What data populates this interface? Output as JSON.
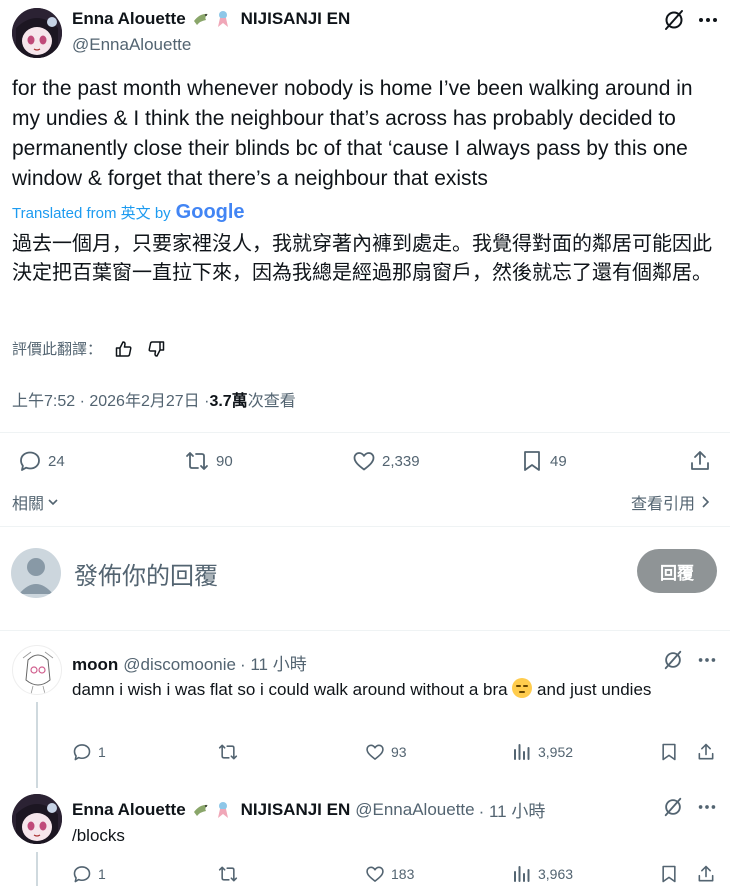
{
  "tweet": {
    "author_name": "Enna Alouette",
    "author_affiliation": "NIJISANJI EN",
    "author_handle": "@EnnaAlouette",
    "text": "for the past month whenever nobody is home I’ve been walking around in my undies & I think the neighbour that’s across has probably decided to permanently close their blinds bc of that ‘cause I always pass by this one window & forget that there’s a neighbour that exists",
    "translated_from": "Translated from 英文 by",
    "translator_logo": "Google",
    "translation": "過去一個月，只要家裡沒人，我就穿著內褲到處走。我覺得對面的鄰居可能因此決定把百葉窗一直拉下來，因為我總是經過那扇窗戶，然後就忘了還有個鄰居。",
    "rate_translation": "評價此翻譯：",
    "time": "上午7:52 · 2026年2月27日 · ",
    "views_count": "3.7萬",
    "views_label": " 次查看",
    "stats": {
      "replies": "24",
      "retweets": "90",
      "likes": "2,339",
      "bookmarks": "49"
    },
    "related": "相關",
    "view_quotes": "查看引用"
  },
  "composer": {
    "placeholder": "發佈你的回覆",
    "reply_button": "回覆"
  },
  "replies": [
    {
      "name": "moon",
      "handle": "@discomoonie",
      "time": "· 11 小時",
      "text_before_emoji": "damn i wish i was flat so i could walk around without a bra ",
      "text_after_emoji": " and just undies",
      "stats": {
        "replies": "1",
        "likes": "93",
        "views": "3,952"
      }
    },
    {
      "name": "Enna Alouette",
      "affiliation": "NIJISANJI EN",
      "handle": "@EnnaAlouette",
      "time": "· 11 小時",
      "text": "/blocks",
      "stats": {
        "replies": "1",
        "likes": "183",
        "views": "3,963"
      }
    }
  ],
  "colors": {
    "text": "#0f1419",
    "secondary": "#536471",
    "google_blue": "#4285F4",
    "divider": "#eff3f4"
  },
  "icons": [
    "grok-icon",
    "more-icon",
    "reply-icon",
    "retweet-icon",
    "like-icon",
    "bookmark-icon",
    "share-icon",
    "views-icon",
    "thumbs-up-icon",
    "thumbs-down-icon",
    "chevron-down-icon",
    "chevron-right-icon",
    "bird-emoji-icon",
    "ribbon-emoji-icon",
    "pensive-emoji-icon"
  ]
}
